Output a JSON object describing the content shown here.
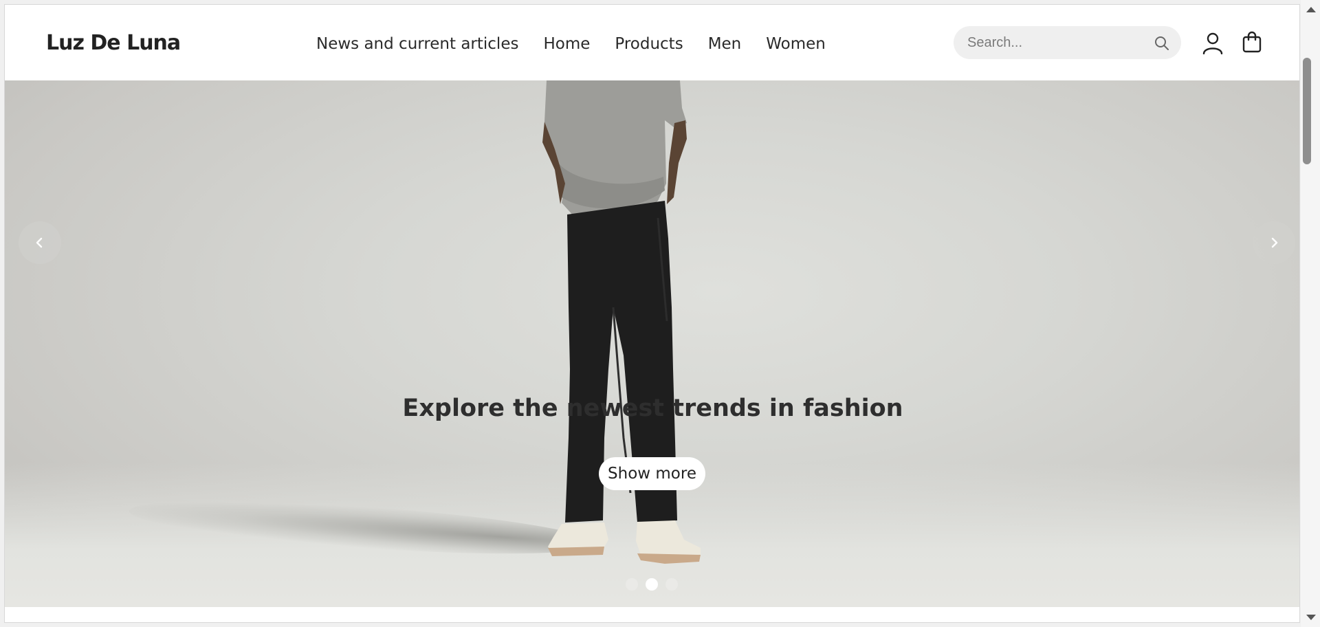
{
  "header": {
    "logo": "Luz De Luna",
    "nav": [
      {
        "label": "News and current articles"
      },
      {
        "label": "Home"
      },
      {
        "label": "Products"
      },
      {
        "label": "Men"
      },
      {
        "label": "Women"
      }
    ],
    "search": {
      "placeholder": "Search...",
      "value": ""
    },
    "icons": {
      "search": "search-icon",
      "account": "user-icon",
      "cart": "shopping-bag-icon"
    }
  },
  "hero": {
    "headline": "Explore the newest trends in fashion",
    "cta_label": "Show more",
    "slides_count": 3,
    "active_slide": 2,
    "prev_icon": "chevron-left-icon",
    "next_icon": "chevron-right-icon"
  },
  "colors": {
    "background": "#d6d7d3",
    "text": "#2e2e2e",
    "button_bg": "#ffffff"
  }
}
